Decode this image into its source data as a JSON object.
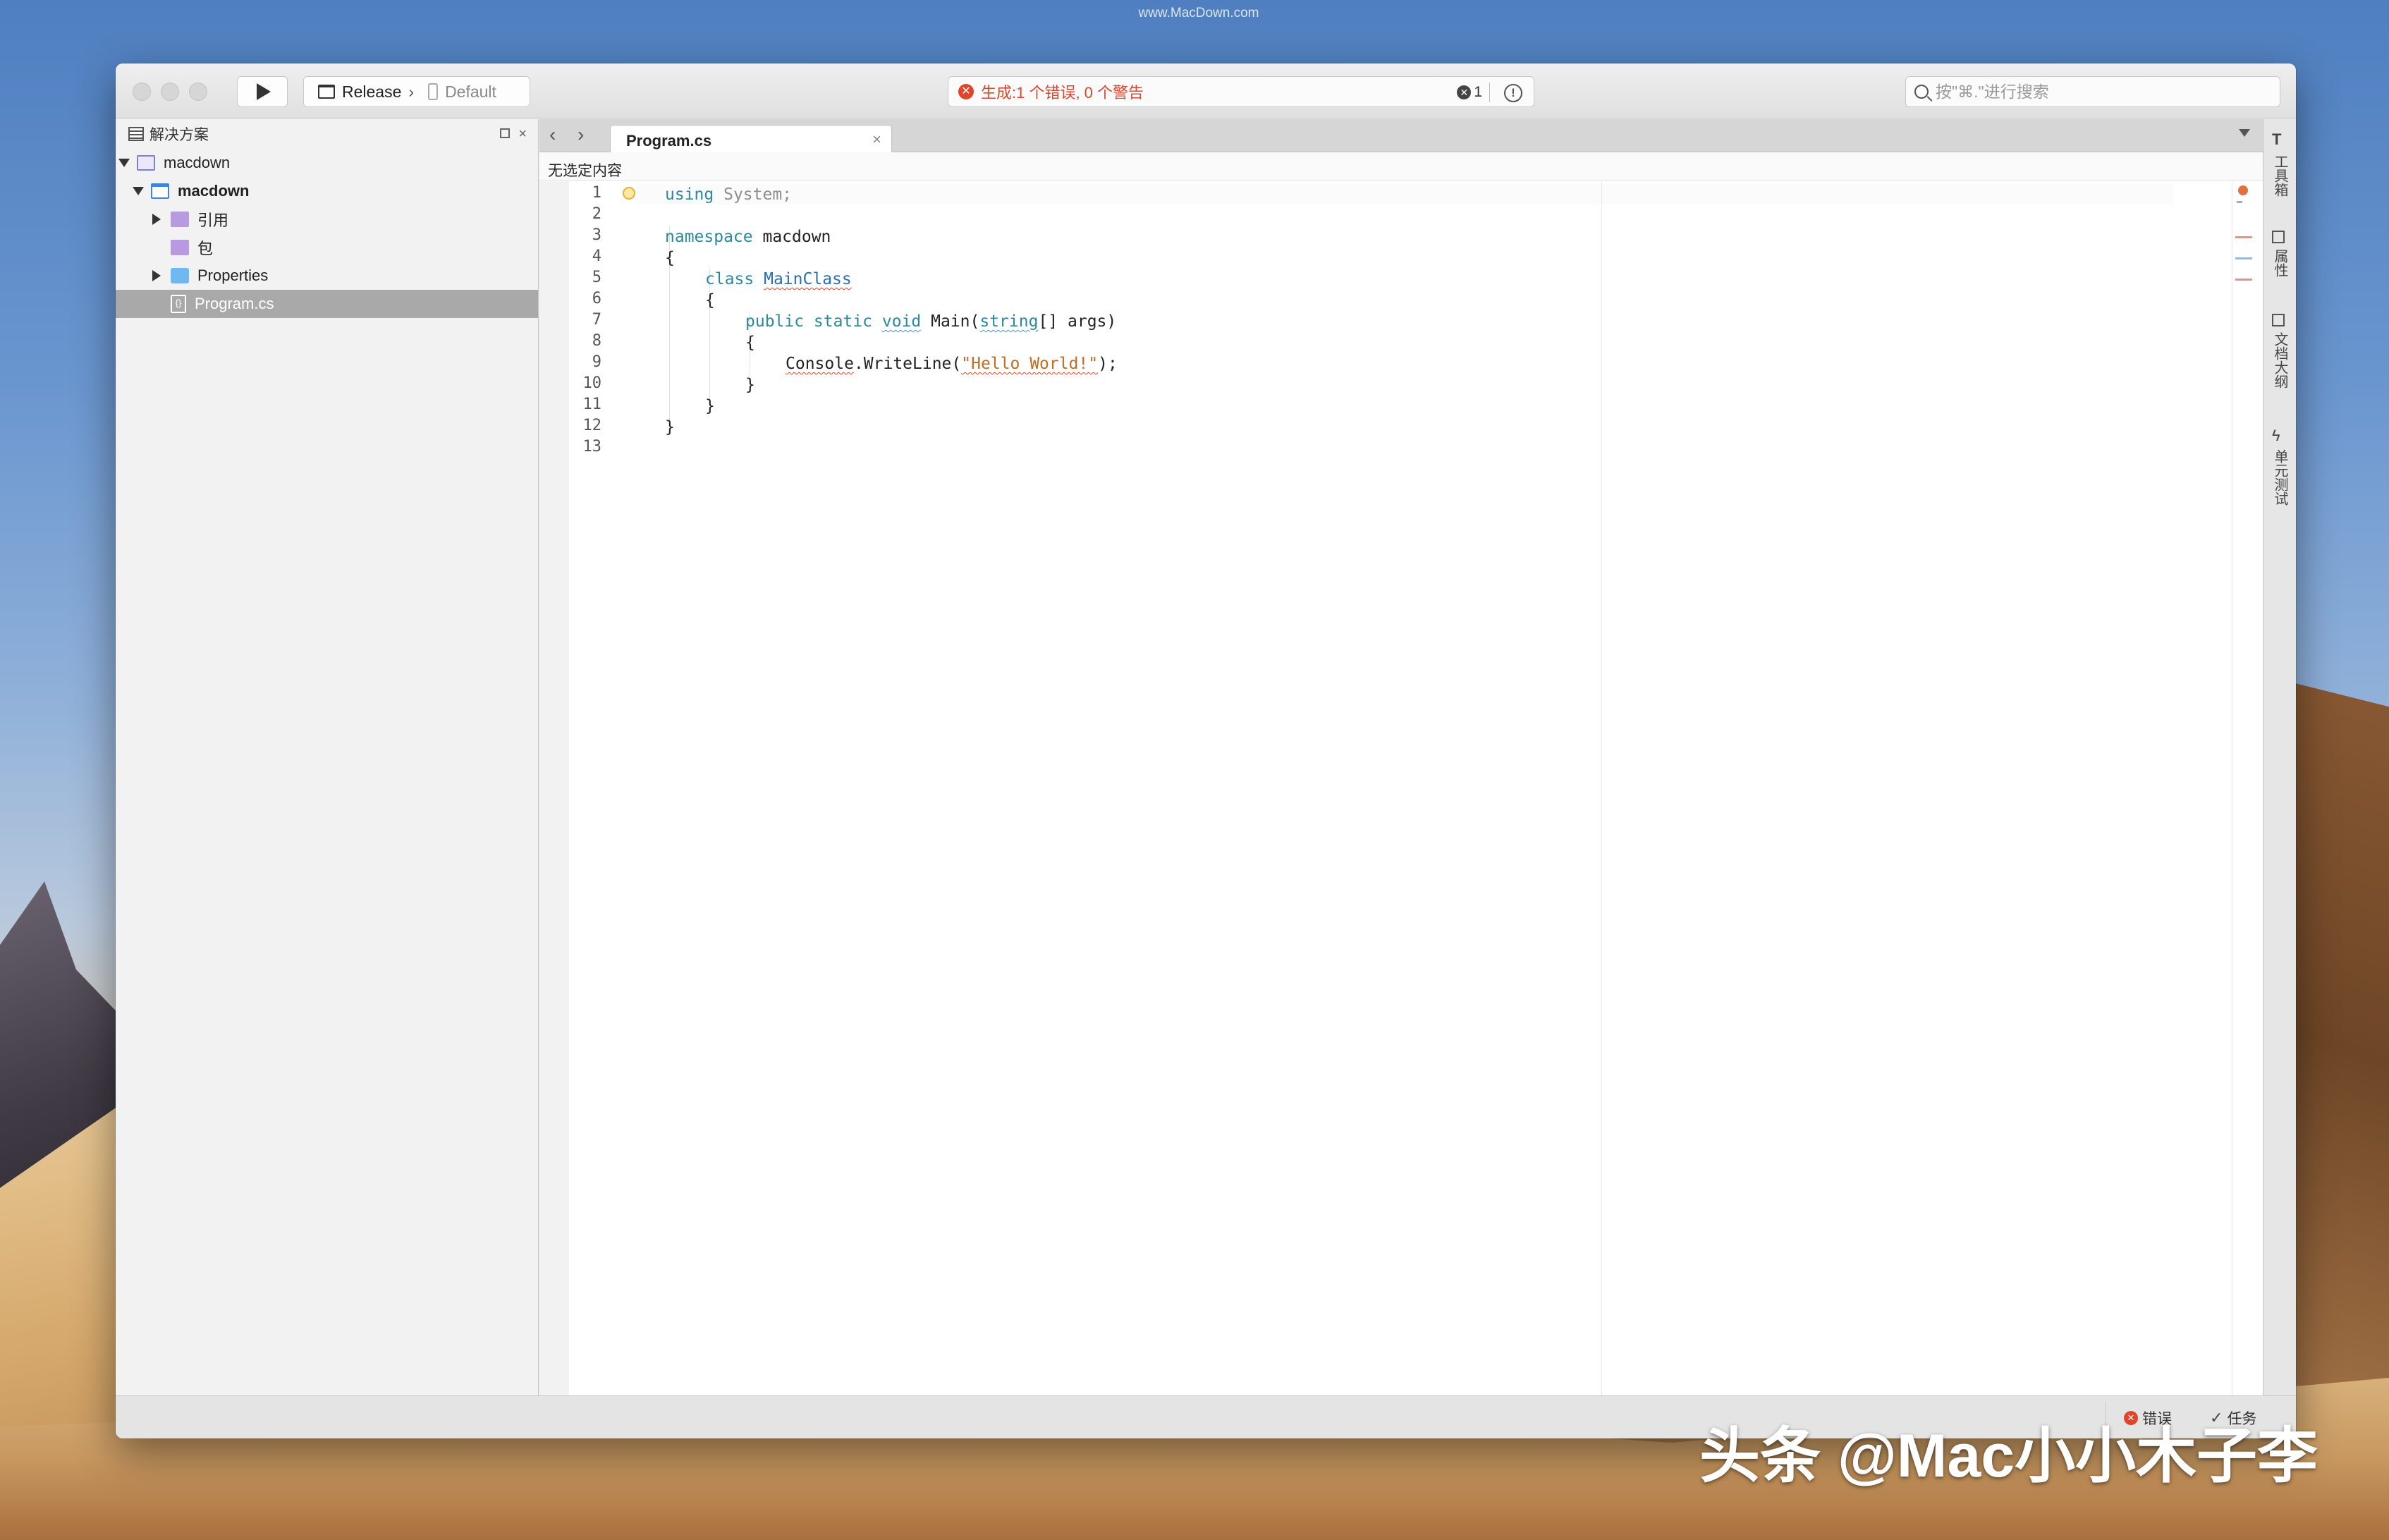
{
  "desktop": {
    "site_mark": "www.MacDown.com",
    "watermark": "头条 @Mac小小木子李"
  },
  "toolbar": {
    "config": "Release",
    "config_separator": "›",
    "device": "Default",
    "status_text": "生成:1 个错误, 0 个警告",
    "error_count": "1",
    "search_placeholder": "按\"⌘.\"进行搜索"
  },
  "solution_pad": {
    "title": "解决方案",
    "tree": [
      {
        "label": "macdown",
        "icon": "solution-icon"
      },
      {
        "label": "macdown",
        "icon": "project-icon"
      },
      {
        "label": "引用",
        "icon": "references-icon"
      },
      {
        "label": "包",
        "icon": "packages-icon"
      },
      {
        "label": "Properties",
        "icon": "folder-icon"
      },
      {
        "label": "Program.cs",
        "icon": "csharp-file-icon"
      }
    ]
  },
  "editor": {
    "tab_label": "Program.cs",
    "path_bar": "无选定内容",
    "line_numbers": [
      "1",
      "2",
      "3",
      "4",
      "5",
      "6",
      "7",
      "8",
      "9",
      "10",
      "11",
      "12",
      "13"
    ],
    "code": {
      "l1_kw": "using",
      "l1_rest": " System;",
      "l3_kw": "namespace",
      "l3_rest": " macdown",
      "open_brace": "{",
      "close_brace": "}",
      "l5_kw": "class",
      "l5_name": "MainClass",
      "l7_mods": "public static",
      "l7_void": "void",
      "l7_main": " Main(",
      "l7_string": "string",
      "l7_args": "[] args)",
      "l9_console": "Console",
      "l9_call": ".WriteLine(",
      "l9_str": "\"Hello World!\"",
      "l9_end": ");"
    }
  },
  "side_pads": [
    "工具箱",
    "属性",
    "文档大纲",
    "单元测试"
  ],
  "statusbar": {
    "errors_label": "错误",
    "tasks_label": "任务"
  },
  "colors": {
    "error": "#e0442a",
    "keyword": "#2b8a9e",
    "string": "#c46b1e",
    "selection": "#a9a9a9"
  }
}
